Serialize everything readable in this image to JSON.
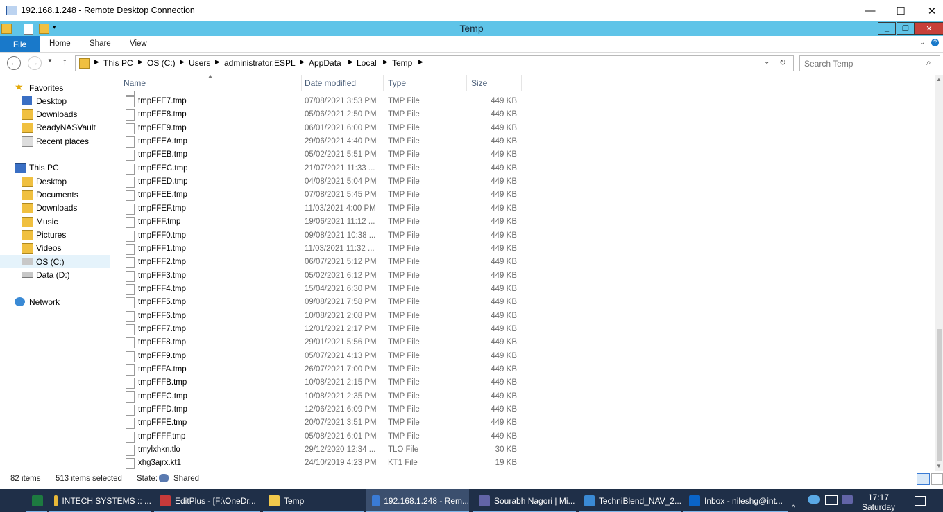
{
  "rdp": {
    "title": "192.168.1.248 - Remote Desktop Connection",
    "minimize": "—",
    "maximize": "☐",
    "close": "✕"
  },
  "explorer": {
    "title": "Temp",
    "min": "_",
    "max": "❐",
    "close": "✕"
  },
  "ribbon": {
    "tabs": [
      "File",
      "Home",
      "Share",
      "View"
    ]
  },
  "address": {
    "crumbs": [
      "This PC",
      "OS (C:)",
      "Users",
      "administrator.ESPL",
      "AppData",
      "Local",
      "Temp"
    ]
  },
  "search": {
    "placeholder": "Search Temp"
  },
  "nav": {
    "favorites": {
      "label": "Favorites",
      "items": [
        "Desktop",
        "Downloads",
        "ReadyNASVault",
        "Recent places"
      ]
    },
    "thispc": {
      "label": "This PC",
      "items": [
        "Desktop",
        "Documents",
        "Downloads",
        "Music",
        "Pictures",
        "Videos",
        "OS (C:)",
        "Data (D:)"
      ]
    },
    "network": {
      "label": "Network"
    }
  },
  "columns": {
    "name": "Name",
    "date": "Date modified",
    "type": "Type",
    "size": "Size"
  },
  "files": [
    {
      "name": "tmpFFE7.tmp",
      "date": "07/08/2021 3:53 PM",
      "type": "TMP File",
      "size": "449 KB"
    },
    {
      "name": "tmpFFE8.tmp",
      "date": "05/06/2021 2:50 PM",
      "type": "TMP File",
      "size": "449 KB"
    },
    {
      "name": "tmpFFE9.tmp",
      "date": "06/01/2021 6:00 PM",
      "type": "TMP File",
      "size": "449 KB"
    },
    {
      "name": "tmpFFEA.tmp",
      "date": "29/06/2021 4:40 PM",
      "type": "TMP File",
      "size": "449 KB"
    },
    {
      "name": "tmpFFEB.tmp",
      "date": "05/02/2021 5:51 PM",
      "type": "TMP File",
      "size": "449 KB"
    },
    {
      "name": "tmpFFEC.tmp",
      "date": "21/07/2021 11:33 ...",
      "type": "TMP File",
      "size": "449 KB"
    },
    {
      "name": "tmpFFED.tmp",
      "date": "04/08/2021 5:04 PM",
      "type": "TMP File",
      "size": "449 KB"
    },
    {
      "name": "tmpFFEE.tmp",
      "date": "07/08/2021 5:45 PM",
      "type": "TMP File",
      "size": "449 KB"
    },
    {
      "name": "tmpFFEF.tmp",
      "date": "11/03/2021 4:00 PM",
      "type": "TMP File",
      "size": "449 KB"
    },
    {
      "name": "tmpFFF.tmp",
      "date": "19/06/2021 11:12 ...",
      "type": "TMP File",
      "size": "449 KB"
    },
    {
      "name": "tmpFFF0.tmp",
      "date": "09/08/2021 10:38 ...",
      "type": "TMP File",
      "size": "449 KB"
    },
    {
      "name": "tmpFFF1.tmp",
      "date": "11/03/2021 11:32 ...",
      "type": "TMP File",
      "size": "449 KB"
    },
    {
      "name": "tmpFFF2.tmp",
      "date": "06/07/2021 5:12 PM",
      "type": "TMP File",
      "size": "449 KB"
    },
    {
      "name": "tmpFFF3.tmp",
      "date": "05/02/2021 6:12 PM",
      "type": "TMP File",
      "size": "449 KB"
    },
    {
      "name": "tmpFFF4.tmp",
      "date": "15/04/2021 6:30 PM",
      "type": "TMP File",
      "size": "449 KB"
    },
    {
      "name": "tmpFFF5.tmp",
      "date": "09/08/2021 7:58 PM",
      "type": "TMP File",
      "size": "449 KB"
    },
    {
      "name": "tmpFFF6.tmp",
      "date": "10/08/2021 2:08 PM",
      "type": "TMP File",
      "size": "449 KB"
    },
    {
      "name": "tmpFFF7.tmp",
      "date": "12/01/2021 2:17 PM",
      "type": "TMP File",
      "size": "449 KB"
    },
    {
      "name": "tmpFFF8.tmp",
      "date": "29/01/2021 5:56 PM",
      "type": "TMP File",
      "size": "449 KB"
    },
    {
      "name": "tmpFFF9.tmp",
      "date": "05/07/2021 4:13 PM",
      "type": "TMP File",
      "size": "449 KB"
    },
    {
      "name": "tmpFFFA.tmp",
      "date": "26/07/2021 7:00 PM",
      "type": "TMP File",
      "size": "449 KB"
    },
    {
      "name": "tmpFFFB.tmp",
      "date": "10/08/2021 2:15 PM",
      "type": "TMP File",
      "size": "449 KB"
    },
    {
      "name": "tmpFFFC.tmp",
      "date": "10/08/2021 2:35 PM",
      "type": "TMP File",
      "size": "449 KB"
    },
    {
      "name": "tmpFFFD.tmp",
      "date": "12/06/2021 6:09 PM",
      "type": "TMP File",
      "size": "449 KB"
    },
    {
      "name": "tmpFFFE.tmp",
      "date": "20/07/2021 3:51 PM",
      "type": "TMP File",
      "size": "449 KB"
    },
    {
      "name": "tmpFFFF.tmp",
      "date": "05/08/2021 6:01 PM",
      "type": "TMP File",
      "size": "449 KB"
    },
    {
      "name": "tmylxhkn.tlo",
      "date": "29/12/2020 12:34 ...",
      "type": "TLO File",
      "size": "30 KB"
    },
    {
      "name": "xhg3ajrx.kt1",
      "date": "24/10/2019 4:23 PM",
      "type": "KT1 File",
      "size": "19 KB"
    }
  ],
  "status": {
    "items": "82 items",
    "selected": "513 items selected",
    "state_label": "State:",
    "state_value": "Shared"
  },
  "taskbar": {
    "apps": [
      {
        "label": "",
        "icon": "excel-icon",
        "color": "#1d7a40"
      },
      {
        "label": "INTECH SYSTEMS :: ...",
        "icon": "chrome-icon",
        "color": "#e8b838"
      },
      {
        "label": "EditPlus - [F:\\OneDr...",
        "icon": "editplus-icon",
        "color": "#c83a3a"
      },
      {
        "label": "Temp",
        "icon": "folder-icon",
        "color": "#f2c94c"
      },
      {
        "label": "192.168.1.248 - Rem...",
        "icon": "remote-desktop-icon",
        "color": "#3a7bd5"
      },
      {
        "label": "Sourabh Nagori | Mi...",
        "icon": "teams-icon",
        "color": "#6264a7"
      },
      {
        "label": "TechniBlend_NAV_2...",
        "icon": "document-icon",
        "color": "#3a8ad5"
      },
      {
        "label": "Inbox - nileshg@int...",
        "icon": "outlook-icon",
        "color": "#0a64c8"
      }
    ],
    "time": "17:17",
    "day": "Saturday"
  }
}
